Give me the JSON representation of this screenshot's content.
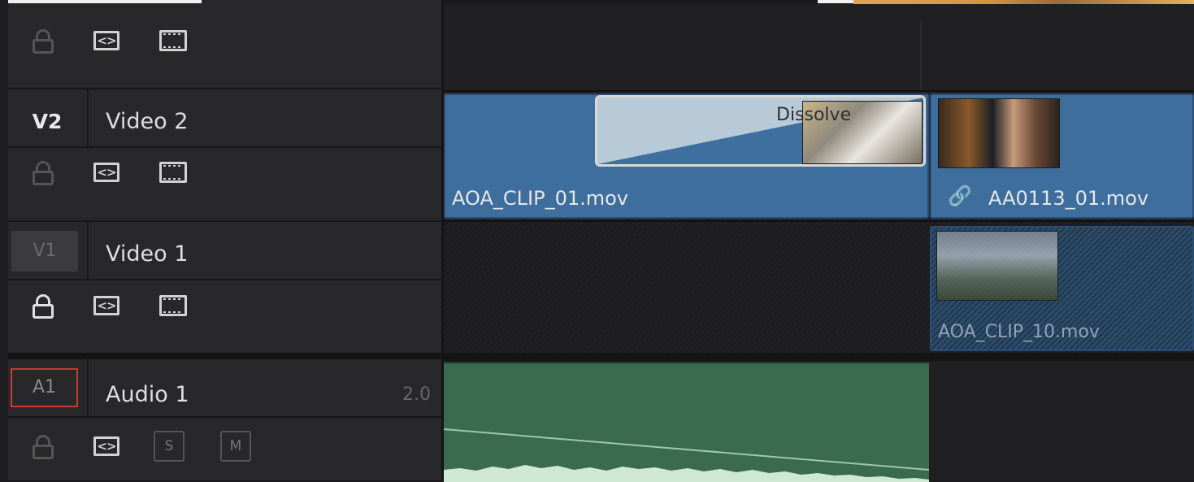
{
  "tracks": {
    "v2": {
      "id": "V2",
      "name": "Video 2"
    },
    "v1": {
      "id": "V1",
      "name": "Video 1"
    },
    "a1": {
      "id": "A1",
      "name": "Audio 1",
      "channels": "2.0"
    }
  },
  "buttons": {
    "autoselect_symbol": "<>",
    "solo_label": "S",
    "mute_label": "M"
  },
  "clips": {
    "v2_left": {
      "name": "AOA_CLIP_01.mov"
    },
    "v2_right": {
      "name": "AA0113_01.mov",
      "link_icon": "🔗"
    },
    "v1_right": {
      "name": "AOA_CLIP_10.mov"
    }
  },
  "transition": {
    "label": "Dissolve"
  },
  "icons": {
    "lock": "lock-icon",
    "autoselect": "auto-select-icon",
    "film": "disable-video-track-icon",
    "link": "link-icon"
  },
  "colors": {
    "video_clip": "#3e6e9e",
    "audio_clip": "#3a6b4f",
    "audio_track_id_border": "#c83a34",
    "panel_bg": "#28282a",
    "timeline_bg": "#1b1b1d"
  }
}
